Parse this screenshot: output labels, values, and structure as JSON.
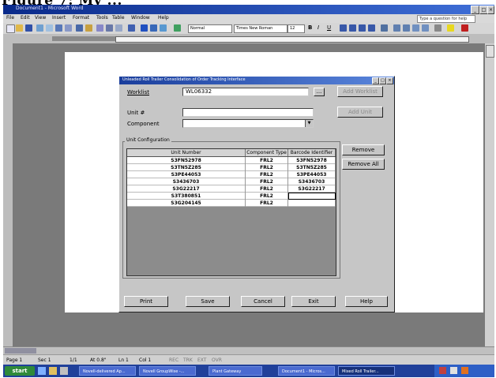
{
  "caption": {
    "text": "Figure 7: My ..."
  },
  "window": {
    "title": "Document1 - Microsoft Word"
  },
  "menu": {
    "items": [
      "File",
      "Edit",
      "View",
      "Insert",
      "Format",
      "Tools",
      "Table",
      "Window",
      "Help"
    ],
    "help_placeholder": "Type a question for help"
  },
  "toolbar": {
    "style": "Normal",
    "font": "Times New Roman",
    "size": "12"
  },
  "status": {
    "page": "Page 1",
    "sec": "Sec 1",
    "pages": "1/1",
    "at": "At 0.8\"",
    "ln": "Ln 1",
    "col": "Col 1",
    "modes": [
      "REC",
      "TRK",
      "EXT",
      "OVR"
    ]
  },
  "taskbar": {
    "start": "start",
    "tasks": [
      "Novell-delivered Ap...",
      "Novell GroupWise -...",
      "Plant Gateway",
      "Document1 - Micros...",
      "Mixed Roll Trailer..."
    ]
  },
  "dialog": {
    "title": "Unleaded Roll Trailer Consolidation of Order Tracking Interface",
    "worklist_label": "Worklist",
    "worklist_value": "WL06332",
    "browse_label": "...",
    "add_worklist_label": "Add Worklist",
    "unit_label": "Unit #",
    "component_label": "Component",
    "add_unit_label": "Add Unit",
    "group_caption": "Unit Configuration",
    "columns": [
      "Unit Number",
      "Component Type",
      "Barcode Identifier"
    ],
    "rows": [
      [
        "S3FN52978",
        "FRL2",
        "S3FN52978"
      ],
      [
        "S3TN5Z285",
        "FRL2",
        "S3TN5Z285"
      ],
      [
        "S3PE44053",
        "FRL2",
        "S3PE44053"
      ],
      [
        "S3436703",
        "FRL2",
        "S3436703"
      ],
      [
        "S3G22217",
        "FRL2",
        "S3G22217"
      ],
      [
        "S3T380851",
        "FRL2",
        ""
      ],
      [
        "S3G204145",
        "FRL2",
        ""
      ]
    ],
    "remove_label": "Remove",
    "remove_all_label": "Remove All",
    "footer_buttons": [
      "Print",
      "Save",
      "Cancel",
      "Exit",
      "Help"
    ]
  }
}
